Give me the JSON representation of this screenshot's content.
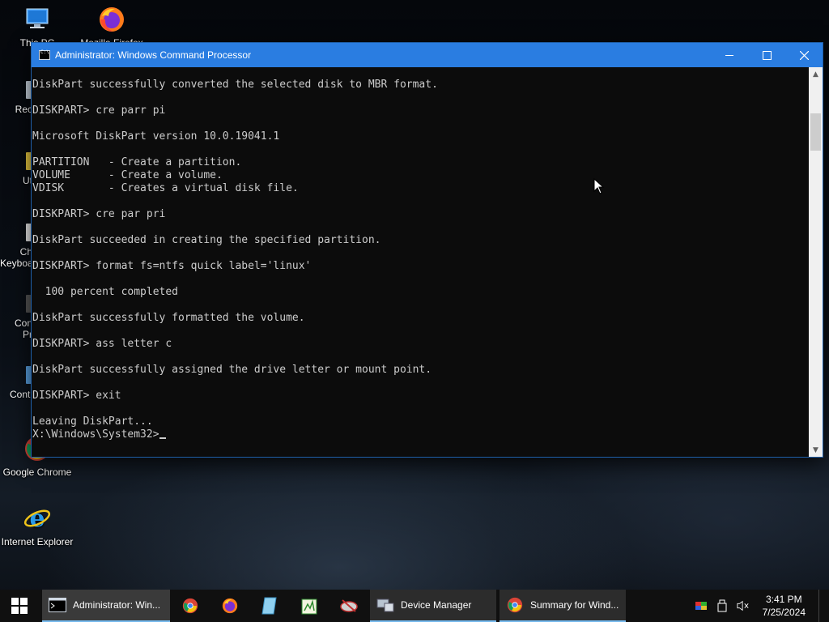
{
  "desktop": {
    "icons": [
      {
        "label": "This PC"
      },
      {
        "label": "Mozilla Firefox"
      },
      {
        "label": "Google Chrome"
      },
      {
        "label": "Internet Explorer"
      }
    ],
    "partial_labels": [
      "Rec",
      "Ut",
      "Ch",
      "Keyboa",
      "Con",
      "Pr",
      "Conti"
    ]
  },
  "window": {
    "title": "Administrator: Windows Command Processor",
    "console_lines": [
      "DiskPart successfully converted the selected disk to MBR format.",
      "",
      "DISKPART> cre parr pi",
      "",
      "Microsoft DiskPart version 10.0.19041.1",
      "",
      "PARTITION   - Create a partition.",
      "VOLUME      - Create a volume.",
      "VDISK       - Creates a virtual disk file.",
      "",
      "DISKPART> cre par pri",
      "",
      "DiskPart succeeded in creating the specified partition.",
      "",
      "DISKPART> format fs=ntfs quick label='linux'",
      "",
      "  100 percent completed",
      "",
      "DiskPart successfully formatted the volume.",
      "",
      "DISKPART> ass letter c",
      "",
      "DiskPart successfully assigned the drive letter or mount point.",
      "",
      "DISKPART> exit",
      "",
      "Leaving DiskPart..."
    ],
    "prompt": "X:\\Windows\\System32>"
  },
  "taskbar": {
    "tasks": [
      {
        "label": "Administrator: Win..."
      },
      {
        "label": "Device Manager"
      },
      {
        "label": "Summary for Wind..."
      }
    ],
    "clock": {
      "time": "3:41 PM",
      "date": "7/25/2024"
    }
  },
  "colors": {
    "titlebar": "#2a7de1",
    "console_bg": "#0c0c0c",
    "console_text": "#cccccc",
    "taskbar": "#101010"
  }
}
